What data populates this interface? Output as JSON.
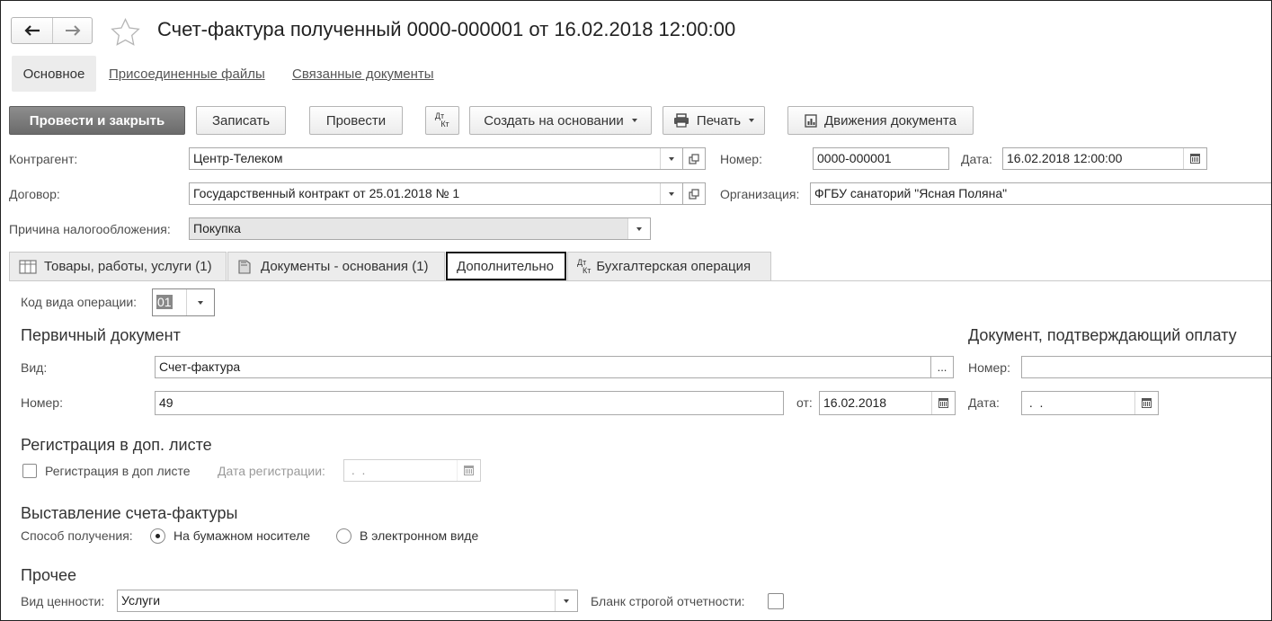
{
  "header": {
    "title": "Счет-фактура полученный 0000-000001 от 16.02.2018 12:00:00",
    "nav_tabs": [
      "Основное",
      "Присоединенные файлы",
      "Связанные документы"
    ]
  },
  "toolbar": {
    "post_close": "Провести и закрыть",
    "save": "Записать",
    "post": "Провести",
    "dtkt_top": "Дт",
    "dtkt_bottom": "Кт",
    "create_based": "Создать на основании",
    "print": "Печать",
    "movements": "Движения документа"
  },
  "form": {
    "counterparty_label": "Контрагент:",
    "counterparty_value": "Центр-Телеком",
    "contract_label": "Договор:",
    "contract_value": "Государственный контракт от 25.01.2018 № 1",
    "reason_label": "Причина налогообложения:",
    "reason_value": "Покупка",
    "number_label": "Номер:",
    "number_value": "0000-000001",
    "date_label": "Дата:",
    "date_value": "16.02.2018 12:00:00",
    "org_label": "Организация:",
    "org_value": "ФГБУ санаторий \"Ясная Поляна\""
  },
  "tabs": [
    {
      "label": "Товары, работы, услуги (1)"
    },
    {
      "label": "Документы - основания (1)"
    },
    {
      "label": "Дополнительно"
    },
    {
      "label": "Бухгалтерская операция"
    }
  ],
  "extra": {
    "op_code_label": "Код вида операции:",
    "op_code_value": "01",
    "primary_doc_title": "Первичный документ",
    "kind_label": "Вид:",
    "kind_value": "Счет-фактура",
    "kind_btn": "...",
    "num_label": "Номер:",
    "num_value": "49",
    "from_label": "от:",
    "from_value": "16.02.2018",
    "payment_doc_title": "Документ, подтверждающий оплату",
    "pay_num_label": "Номер:",
    "pay_num_value": "",
    "pay_date_label": "Дата:",
    "pay_date_value": " .  .",
    "reg_title": "Регистрация в доп. листе",
    "reg_checkbox_label": "Регистрация в доп листе",
    "reg_date_label": "Дата регистрации:",
    "reg_date_value": " .  .",
    "issue_title": "Выставление счета-фактуры",
    "receive_label": "Способ получения:",
    "radio_paper": "На бумажном носителе",
    "radio_electronic": "В электронном виде",
    "other_title": "Прочее",
    "value_type_label": "Вид ценности:",
    "value_type_value": "Услуги",
    "strict_form_label": "Бланк строгой отчетности:"
  }
}
